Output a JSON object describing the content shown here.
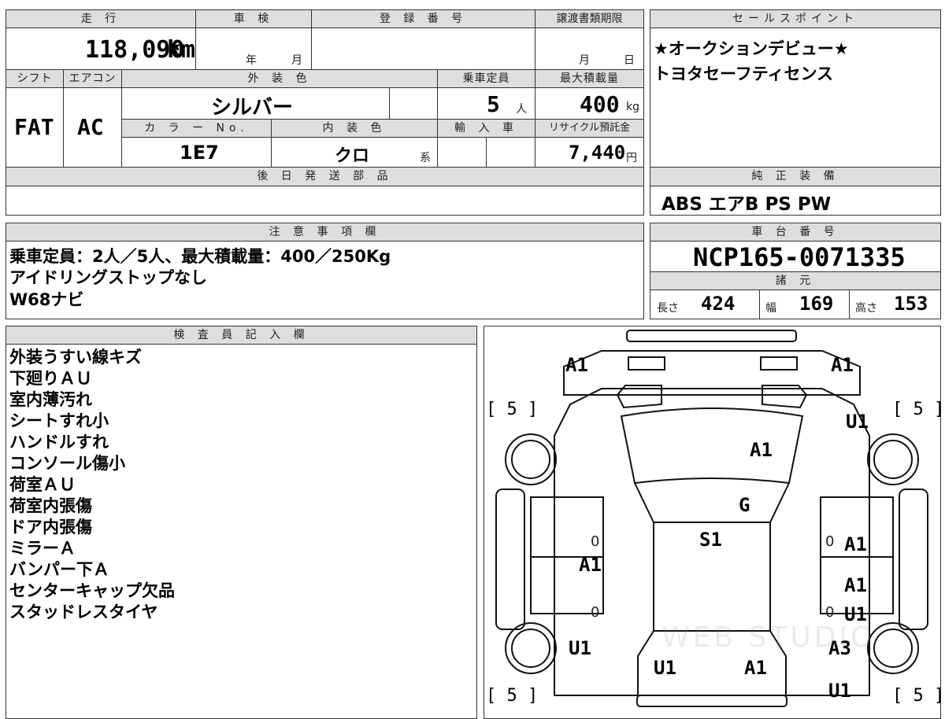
{
  "labels": {
    "mileage": "走 行",
    "inspection": "車 検",
    "registration": "登 録 番 号",
    "transfer_deadline": "譲渡書類期限",
    "sales_points": "セールスポイント",
    "shift": "シフト",
    "aircon": "エアコン",
    "exterior_color": "外 装 色",
    "capacity": "乗車定員",
    "max_load": "最大積載量",
    "color_no": "カ ラ ー No.",
    "interior_color": "内 装 色",
    "import": "輸 入 車",
    "recycle": "リサイクル預託金",
    "later_parts": "後 日 発 送 部 品",
    "factory_equipment": "純 正 装 備",
    "notes": "注 意 事 項 欄",
    "chassis_no": "車 台 番 号",
    "specs": "諸 元",
    "inspector": "検 査 員 記 入 欄",
    "year": "年",
    "month": "月",
    "day": "日"
  },
  "vehicle": {
    "mileage": "118,090",
    "mileage_unit": "km",
    "shift": "FAT",
    "aircon": "AC",
    "exterior_color": "シルバー",
    "capacity": "5",
    "capacity_unit": "人",
    "max_load": "400",
    "max_load_unit": "kg",
    "color_no": "1E7",
    "interior_color": "クロ",
    "interior_suffix": "系",
    "recycle_fee": "7,440",
    "recycle_unit": "円",
    "chassis_no": "NCP165-0071335"
  },
  "sales_points": [
    "★オークションデビュー★",
    "トヨタセーフティセンス"
  ],
  "equipment": "ABS エアB PS PW",
  "notes": [
    "乗車定員：2人／5人、最大積載量：400／250Kg",
    "アイドリングストップなし",
    "W68ナビ"
  ],
  "specs": {
    "length_label": "長さ",
    "length": "424",
    "width_label": "幅",
    "width": "169",
    "height_label": "高さ",
    "height": "153"
  },
  "inspector_notes": [
    "外装うすい線キズ",
    "下廻りＡＵ",
    "室内薄汚れ",
    "シートすれ小",
    "ハンドルすれ",
    "コンソール傷小",
    "荷室ＡＵ",
    "荷室内張傷",
    "ドア内張傷",
    "ミラーＡ",
    "バンパー下Ａ",
    "センターキャップ欠品",
    "スタッドレスタイヤ"
  ],
  "damage_map": {
    "tire_depth": [
      "[ 5 ]",
      "[ 5 ]",
      "[ 5 ]",
      "[ 5 ]"
    ],
    "marks": [
      "A1",
      "A1",
      "U1",
      "A1",
      "G",
      "S1",
      "A1",
      "A1",
      "A1",
      "U1",
      "U1",
      "A3",
      "U1",
      "A1",
      "U1"
    ],
    "zeros": [
      "0",
      "0",
      "0",
      "0"
    ],
    "watermark": "WEB STUDIO"
  }
}
